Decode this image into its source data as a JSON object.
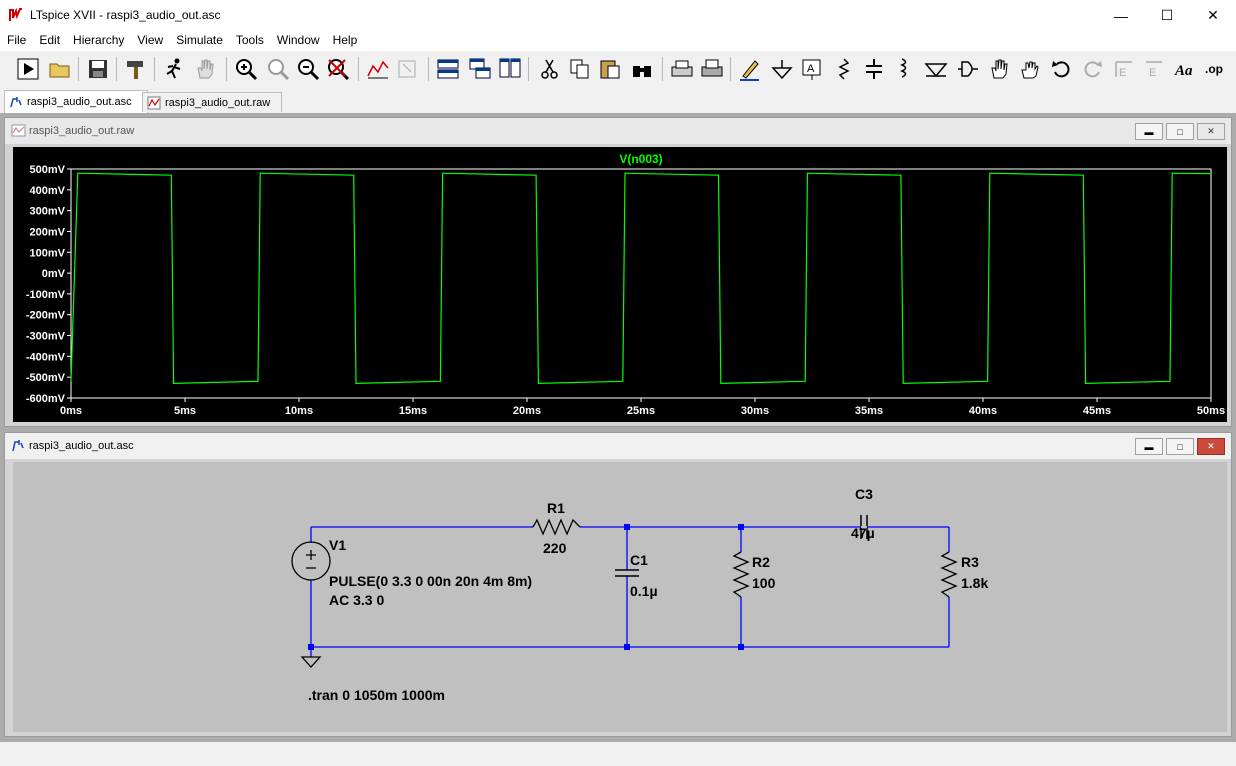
{
  "window": {
    "title": "LTspice XVII - raspi3_audio_out.asc"
  },
  "menu": [
    "File",
    "Edit",
    "Hierarchy",
    "View",
    "Simulate",
    "Tools",
    "Window",
    "Help"
  ],
  "tabs": [
    {
      "label": "raspi3_audio_out.asc",
      "active": true
    },
    {
      "label": "raspi3_audio_out.raw",
      "active": false
    }
  ],
  "waveform_window": {
    "title": "raspi3_audio_out.raw"
  },
  "schematic_window": {
    "title": "raspi3_audio_out.asc"
  },
  "colors": {
    "trace": "#00ff00",
    "wire": "#0000ff",
    "component": "#000000",
    "plot_bg": "#000000",
    "schematic_bg": "#c0c0c0"
  },
  "chart_data": {
    "type": "line",
    "title": "V(n003)",
    "series": [
      {
        "name": "V(n003)",
        "x_ms": [
          0,
          0.3,
          4.4,
          4.5,
          8.2,
          8.3,
          12.4,
          12.5,
          16.2,
          16.3,
          20.4,
          20.5,
          24.2,
          24.3,
          28.4,
          28.5,
          32.2,
          32.3,
          36.4,
          36.5,
          40.2,
          40.3,
          44.4,
          44.5,
          48.2,
          48.3,
          50
        ],
        "y_mV": [
          -520,
          480,
          470,
          -530,
          -520,
          480,
          470,
          -530,
          -520,
          480,
          470,
          -530,
          -520,
          480,
          470,
          -530,
          -520,
          480,
          470,
          -530,
          -520,
          480,
          470,
          -530,
          -520,
          480,
          478
        ]
      }
    ],
    "xlim_ms": [
      0,
      50
    ],
    "ylim_mV": [
      -600,
      500
    ],
    "x_ticks": [
      "0ms",
      "5ms",
      "10ms",
      "15ms",
      "20ms",
      "25ms",
      "30ms",
      "35ms",
      "40ms",
      "45ms",
      "50ms"
    ],
    "y_ticks": [
      "500mV",
      "400mV",
      "300mV",
      "200mV",
      "100mV",
      "0mV",
      "-100mV",
      "-200mV",
      "-300mV",
      "-400mV",
      "-500mV",
      "-600mV"
    ]
  },
  "schematic": {
    "V1": {
      "name": "V1",
      "value": "PULSE(0 3.3 0 00n 20n 4m 8m)",
      "ac": "AC 3.3 0"
    },
    "R1": {
      "name": "R1",
      "value": "220"
    },
    "C1": {
      "name": "C1",
      "value": "0.1µ"
    },
    "R2": {
      "name": "R2",
      "value": "100"
    },
    "C3": {
      "name": "C3",
      "value": "47µ"
    },
    "R3": {
      "name": "R3",
      "value": "1.8k"
    },
    "directive": ".tran 0 1050m 1000m"
  }
}
